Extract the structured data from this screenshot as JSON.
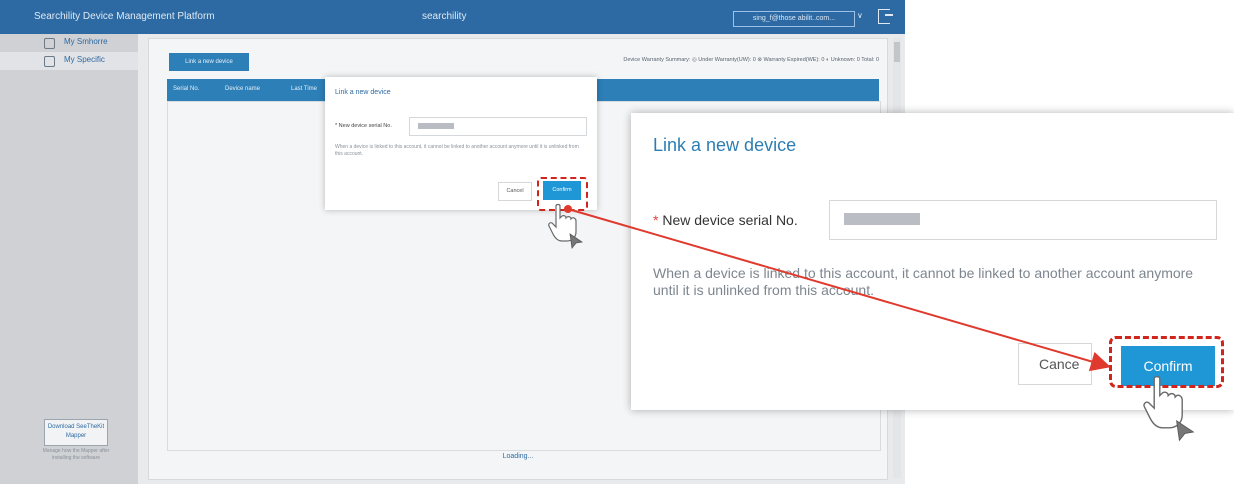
{
  "app": {
    "title": "Searchility Device Management Platform",
    "center_title": "searchility",
    "account": "sing_f@those abilit..com..."
  },
  "sidebar": {
    "items": [
      {
        "label": "My Smhorre"
      },
      {
        "label": "My Specific"
      }
    ],
    "download_button": "Download SeeTheKit Mapper",
    "download_note": "Manage how the Mapper after installing the software"
  },
  "main": {
    "link_button": "Link a new device",
    "summary": "Device Warranty Summary: ◎ Under Warranty(UW): 0  ⊗ Warranty Expired(WE): 0  ◐ Unknown: 0  Total: 0",
    "columns": [
      "Serial No.",
      "Device name",
      "Last Time"
    ],
    "loading": "Loading..."
  },
  "dialog": {
    "title": "Link a new device",
    "field_required": "*",
    "field_label": "New device serial No.",
    "field_label_small": "* New device serial No.",
    "info": "When a device is linked to this account, it cannot be linked to another account anymore until it is unlinked from this account.",
    "cancel": "Cancel",
    "cancel_visible": "Cance",
    "confirm": "Confirm"
  },
  "colors": {
    "brand": "#2d6aa3",
    "accent": "#1f97d6",
    "highlight": "#d0251d"
  }
}
